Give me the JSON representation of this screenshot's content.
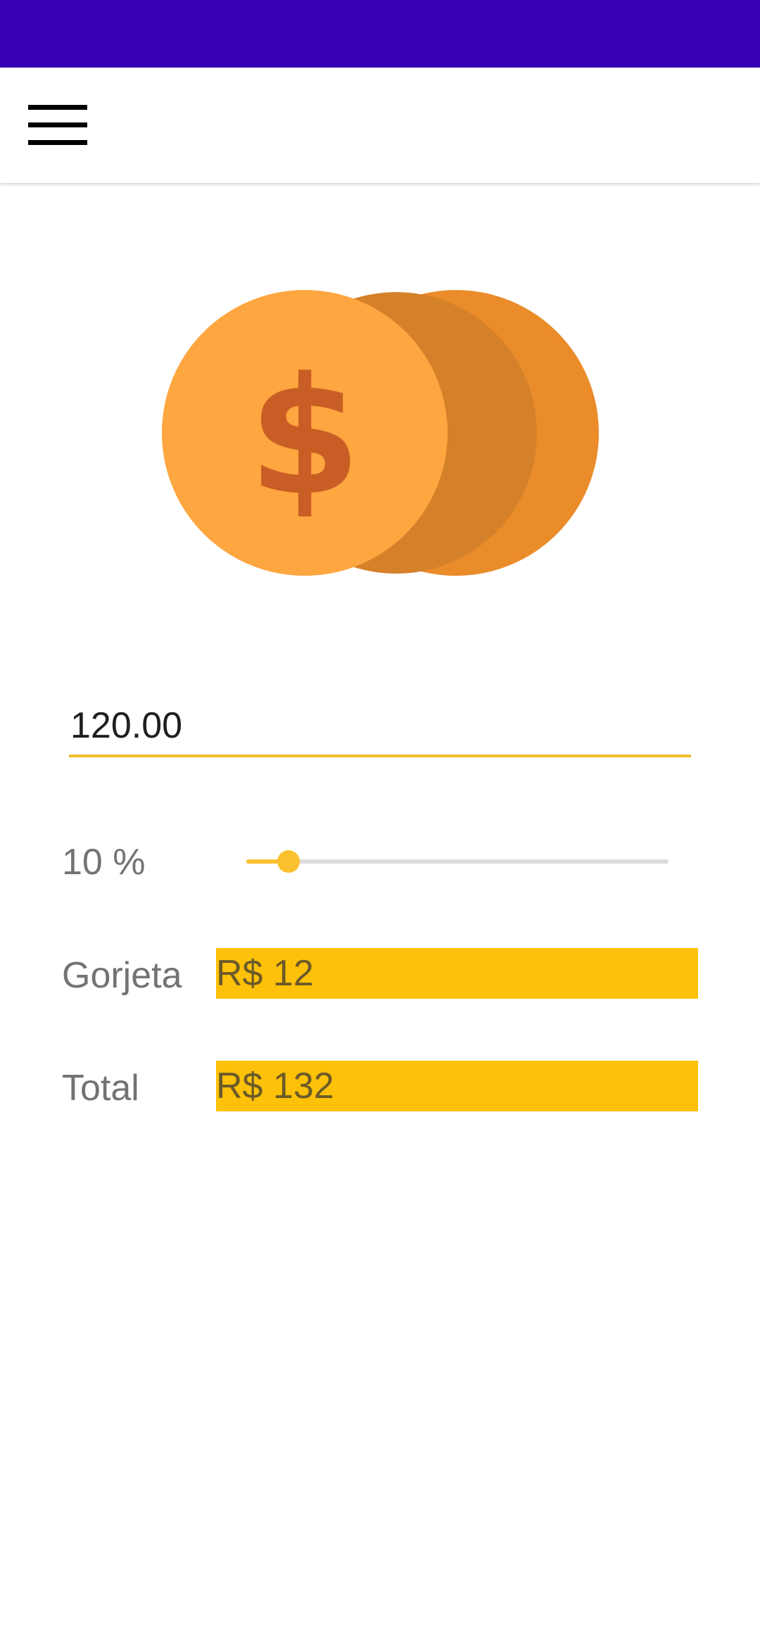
{
  "colors": {
    "status_bar": "#3700b3",
    "accent": "#fbc02d",
    "value_box": "#fdc109",
    "label_text": "#737373"
  },
  "app_bar": {
    "menu_icon": "hamburger-menu-icon"
  },
  "illustration": {
    "icon": "coins-dollar-icon"
  },
  "bill": {
    "value": "120.00"
  },
  "tip_slider": {
    "label": "10 %",
    "percent": 10,
    "fraction": 0.1
  },
  "tip": {
    "label": "Gorjeta",
    "value": "R$ 12"
  },
  "total": {
    "label": "Total",
    "value": "R$ 132"
  }
}
